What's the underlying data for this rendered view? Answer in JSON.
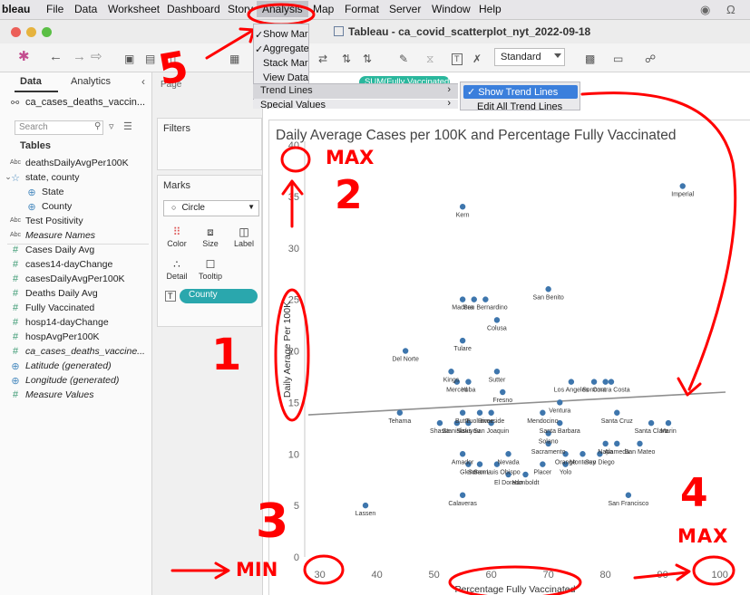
{
  "menubar": {
    "app": "bleau",
    "items": [
      "File",
      "Data",
      "Worksheet",
      "Dashboard",
      "Story",
      "Analysis",
      "Map",
      "Format",
      "Server",
      "Window",
      "Help"
    ],
    "active": "Analysis"
  },
  "window": {
    "title": "Tableau - ca_covid_scatterplot_nyt_2022-09-18"
  },
  "toolbar": {
    "fit_value": "Standard"
  },
  "analysis_menu": {
    "items": [
      {
        "label": "Show Mar",
        "checked": true
      },
      {
        "label": "Aggregate",
        "checked": true
      },
      {
        "label": "Stack Mar",
        "checked": false
      },
      {
        "label": "View Datapan",
        "checked": false
      }
    ],
    "trend_lines": "Trend Lines",
    "special_values": "Special Values",
    "submenu": {
      "show_trend_lines": "Show Trend Lines",
      "edit_all_trend_lines": "Edit All Trend Lines"
    }
  },
  "data_pane": {
    "tab_data": "Data",
    "tab_analytics": "Analytics",
    "datasource": "ca_cases_deaths_vaccin...",
    "search_placeholder": "Search",
    "tables_header": "Tables",
    "fields": [
      {
        "icon": "abc",
        "label": "deathsDailyAvgPer100K",
        "italic": false
      },
      {
        "icon": "hierarchy",
        "label": "state, county",
        "italic": false
      },
      {
        "icon": "globe",
        "label": "State",
        "italic": false
      },
      {
        "icon": "globe",
        "label": "County",
        "italic": false
      },
      {
        "icon": "abc",
        "label": "Test Positivity",
        "italic": false
      },
      {
        "icon": "abc",
        "label": "Measure Names",
        "italic": true
      },
      {
        "icon": "hash",
        "label": "Cases Daily Avg",
        "italic": false
      },
      {
        "icon": "hash",
        "label": "cases14-dayChange",
        "italic": false
      },
      {
        "icon": "hash",
        "label": "casesDailyAvgPer100K",
        "italic": false
      },
      {
        "icon": "hash",
        "label": "Deaths Daily Avg",
        "italic": false
      },
      {
        "icon": "hash",
        "label": "Fully Vaccinated",
        "italic": false
      },
      {
        "icon": "hash",
        "label": "hosp14-dayChange",
        "italic": false
      },
      {
        "icon": "hash",
        "label": "hospAvgPer100K",
        "italic": false
      },
      {
        "icon": "hash",
        "label": "ca_cases_deaths_vaccine...",
        "italic": true
      },
      {
        "icon": "globe",
        "label": "Latitude (generated)",
        "italic": true
      },
      {
        "icon": "globe",
        "label": "Longitude (generated)",
        "italic": true
      },
      {
        "icon": "hash",
        "label": "Measure Values",
        "italic": true
      }
    ]
  },
  "shelves": {
    "pages": "Page",
    "filters": "Filters",
    "marks": "Marks",
    "mark_type": "Circle",
    "buttons": [
      "Color",
      "Size",
      "Label",
      "Detail",
      "Tooltip"
    ],
    "county_pill": "County",
    "columns_pill": "SUM(Fully Vaccinated)"
  },
  "chart_data": {
    "type": "scatter",
    "title": "Daily Average Cases per 100K and Percentage Fully Vaccinated",
    "xlabel": "Percentage Fully Vaccinated",
    "ylabel": "Daily Aerage Per 100K",
    "xlim": [
      28,
      101
    ],
    "ylim": [
      0,
      40
    ],
    "xticks": [
      30,
      40,
      50,
      60,
      70,
      80,
      90,
      100
    ],
    "yticks": [
      0,
      5,
      10,
      15,
      20,
      25,
      30,
      35,
      40
    ],
    "grid": false,
    "trend_line": {
      "x": [
        28,
        101
      ],
      "y": [
        13.8,
        16.0
      ]
    },
    "points": [
      {
        "label": "Imperial",
        "x": 93.5,
        "y": 36
      },
      {
        "label": "Kern",
        "x": 55,
        "y": 34
      },
      {
        "label": "San Benito",
        "x": 70,
        "y": 26
      },
      {
        "label": "Madera",
        "x": 55,
        "y": 25
      },
      {
        "label": "San Bernardino",
        "x": 59,
        "y": 25
      },
      {
        "label": "",
        "x": 57,
        "y": 25
      },
      {
        "label": "Colusa",
        "x": 61,
        "y": 23
      },
      {
        "label": "Tulare",
        "x": 55,
        "y": 21
      },
      {
        "label": "Del Norte",
        "x": 45,
        "y": 20
      },
      {
        "label": "Kings",
        "x": 53,
        "y": 18
      },
      {
        "label": "Sutter",
        "x": 61,
        "y": 18
      },
      {
        "label": "Merced",
        "x": 54,
        "y": 17
      },
      {
        "label": "Yuba",
        "x": 56,
        "y": 17
      },
      {
        "label": "Los Angeles",
        "x": 74,
        "y": 17
      },
      {
        "label": "Sonoma",
        "x": 78,
        "y": 17
      },
      {
        "label": "Contra Costa",
        "x": 81,
        "y": 17
      },
      {
        "label": "",
        "x": 80,
        "y": 17
      },
      {
        "label": "Fresno",
        "x": 62,
        "y": 16
      },
      {
        "label": "Ventura",
        "x": 72,
        "y": 15
      },
      {
        "label": "Mendocino",
        "x": 69,
        "y": 14
      },
      {
        "label": "Butte",
        "x": 55,
        "y": 14
      },
      {
        "label": "Tuolumne",
        "x": 58,
        "y": 14
      },
      {
        "label": "Riverside",
        "x": 60,
        "y": 14
      },
      {
        "label": "Santa Cruz",
        "x": 82,
        "y": 14
      },
      {
        "label": "Tehama",
        "x": 44,
        "y": 14
      },
      {
        "label": "Shasta",
        "x": 51,
        "y": 13
      },
      {
        "label": "Stanislaus",
        "x": 54,
        "y": 13
      },
      {
        "label": "Siskiyou",
        "x": 56,
        "y": 13
      },
      {
        "label": "San Joaquin",
        "x": 60,
        "y": 13
      },
      {
        "label": "Santa Barbara",
        "x": 72,
        "y": 13
      },
      {
        "label": "Santa Clara",
        "x": 88,
        "y": 13
      },
      {
        "label": "Marin",
        "x": 91,
        "y": 13
      },
      {
        "label": "Solano",
        "x": 70,
        "y": 12
      },
      {
        "label": "Sacramento",
        "x": 70,
        "y": 11
      },
      {
        "label": "Napa",
        "x": 80,
        "y": 11
      },
      {
        "label": "Alameda",
        "x": 82,
        "y": 11
      },
      {
        "label": "San Mateo",
        "x": 86,
        "y": 11
      },
      {
        "label": "Amador",
        "x": 55,
        "y": 10
      },
      {
        "label": "Nevada",
        "x": 63,
        "y": 10
      },
      {
        "label": "Orange",
        "x": 73,
        "y": 10
      },
      {
        "label": "Monterey",
        "x": 76,
        "y": 10
      },
      {
        "label": "San Diego",
        "x": 79,
        "y": 10
      },
      {
        "label": "Glenn",
        "x": 56,
        "y": 9
      },
      {
        "label": "Sonoma",
        "x": 58,
        "y": 9
      },
      {
        "label": "San Luis Obispo",
        "x": 61,
        "y": 9
      },
      {
        "label": "Placer",
        "x": 69,
        "y": 9
      },
      {
        "label": "Yolo",
        "x": 73,
        "y": 9
      },
      {
        "label": "El Dorado",
        "x": 63,
        "y": 8
      },
      {
        "label": "Humboldt",
        "x": 66,
        "y": 8
      },
      {
        "label": "Calaveras",
        "x": 55,
        "y": 6
      },
      {
        "label": "San Francisco",
        "x": 84,
        "y": 6
      },
      {
        "label": "Lassen",
        "x": 38,
        "y": 5
      }
    ]
  },
  "annotations": {
    "max_top": "MAX",
    "num2": "2",
    "num1": "1",
    "num3": "3",
    "num4": "4",
    "num5": "5",
    "min": "MIN",
    "max_bottom": "MAX"
  }
}
